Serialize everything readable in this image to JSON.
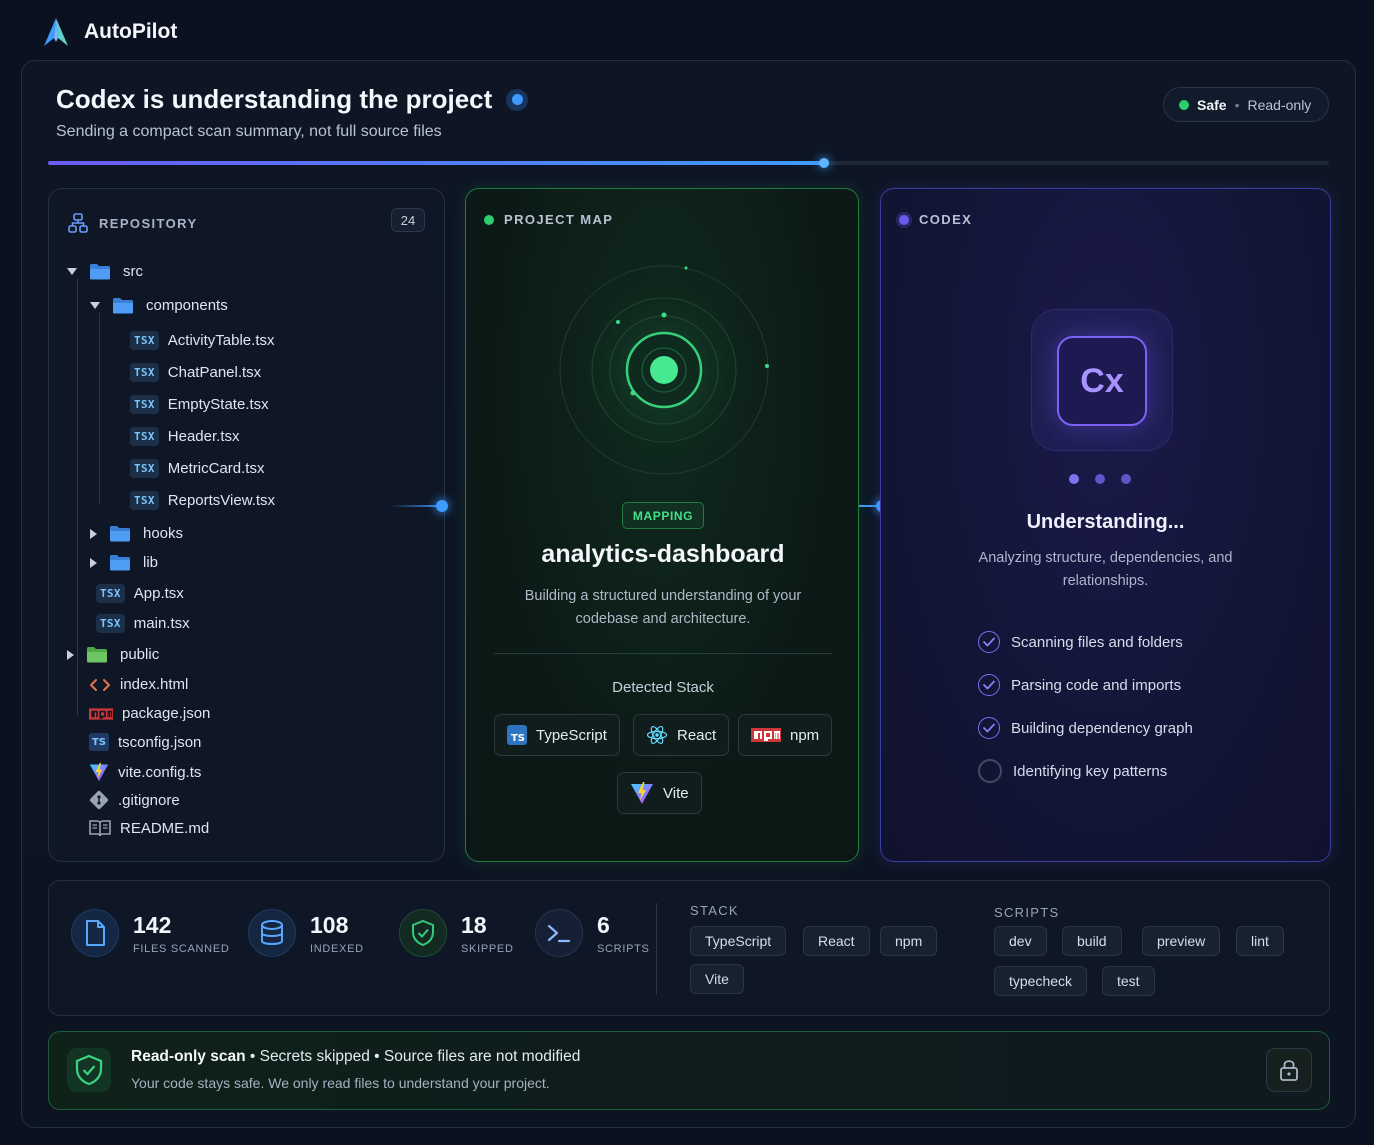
{
  "app": {
    "title": "AutoPilot"
  },
  "header": {
    "title": "Codex is understanding the project",
    "subtitle": "Sending a compact scan summary, not full source files",
    "safe_label": "Safe",
    "separator": "•",
    "mode_label": "Read-only",
    "progress": 0.606
  },
  "repository": {
    "title": "REPOSITORY",
    "count": "24",
    "tree": [
      {
        "label": "src",
        "type": "folder",
        "state": "open"
      },
      {
        "label": "components",
        "type": "folder",
        "state": "open"
      },
      {
        "label": "ActivityTable.tsx",
        "type": "tsx",
        "badge": "TSX"
      },
      {
        "label": "ChatPanel.tsx",
        "type": "tsx",
        "badge": "TSX"
      },
      {
        "label": "EmptyState.tsx",
        "type": "tsx",
        "badge": "TSX"
      },
      {
        "label": "Header.tsx",
        "type": "tsx",
        "badge": "TSX"
      },
      {
        "label": "MetricCard.tsx",
        "type": "tsx",
        "badge": "TSX"
      },
      {
        "label": "ReportsView.tsx",
        "type": "tsx",
        "badge": "TSX"
      },
      {
        "label": "hooks",
        "type": "folder",
        "state": "closed"
      },
      {
        "label": "lib",
        "type": "folder",
        "state": "closed"
      },
      {
        "label": "App.tsx",
        "type": "tsx",
        "badge": "TSX"
      },
      {
        "label": "main.tsx",
        "type": "tsx",
        "badge": "TSX"
      },
      {
        "label": "public",
        "type": "folder-green",
        "state": "closed"
      },
      {
        "label": "index.html",
        "type": "html-icon"
      },
      {
        "label": "package.json",
        "type": "npm-icon"
      },
      {
        "label": "tsconfig.json",
        "type": "ts-icon",
        "badge": "TS"
      },
      {
        "label": "vite.config.ts",
        "type": "vite-icon"
      },
      {
        "label": ".gitignore",
        "type": "git-icon"
      },
      {
        "label": "README.md",
        "type": "book-icon"
      }
    ]
  },
  "project_map": {
    "title": "PROJECT MAP",
    "badge": "MAPPING",
    "name": "analytics-dashboard",
    "description": "Building a structured understanding of your codebase and architecture.",
    "detected_label": "Detected Stack",
    "stack": [
      {
        "label": "TypeScript",
        "icon": "typescript-icon",
        "badge": "TS"
      },
      {
        "label": "React",
        "icon": "react-icon"
      },
      {
        "label": "npm",
        "icon": "npm-icon"
      },
      {
        "label": "Vite",
        "icon": "vite-icon"
      }
    ]
  },
  "codex": {
    "title": "CODEX",
    "logo_text": "Cx",
    "status": "Understanding...",
    "description": "Analyzing structure, dependencies, and relationships.",
    "steps": [
      {
        "label": "Scanning files and folders",
        "done": true
      },
      {
        "label": "Parsing code and imports",
        "done": true
      },
      {
        "label": "Building dependency graph",
        "done": true
      },
      {
        "label": "Identifying key patterns",
        "done": false
      }
    ]
  },
  "stats": {
    "items": [
      {
        "value": "142",
        "label": "FILES SCANNED",
        "icon": "file-icon"
      },
      {
        "value": "108",
        "label": "INDEXED",
        "icon": "database-icon"
      },
      {
        "value": "18",
        "label": "SKIPPED",
        "icon": "shield-check-icon"
      },
      {
        "value": "6",
        "label": "SCRIPTS",
        "icon": "terminal-icon"
      }
    ],
    "stack_label": "STACK",
    "stack_tags": [
      "TypeScript",
      "React",
      "npm",
      "Vite"
    ],
    "scripts_label": "SCRIPTS",
    "script_tags": [
      "dev",
      "build",
      "preview",
      "lint",
      "typecheck",
      "test"
    ]
  },
  "footer": {
    "bold": "Read-only scan",
    "rest": " • Secrets skipped • Source files are not modified",
    "note": "Your code stays safe. We only read files to understand your project."
  },
  "colors": {
    "accent_blue": "#3d9bff",
    "accent_green": "#2ccf6d",
    "accent_purple": "#7a62f5",
    "background": "#0b1120"
  }
}
